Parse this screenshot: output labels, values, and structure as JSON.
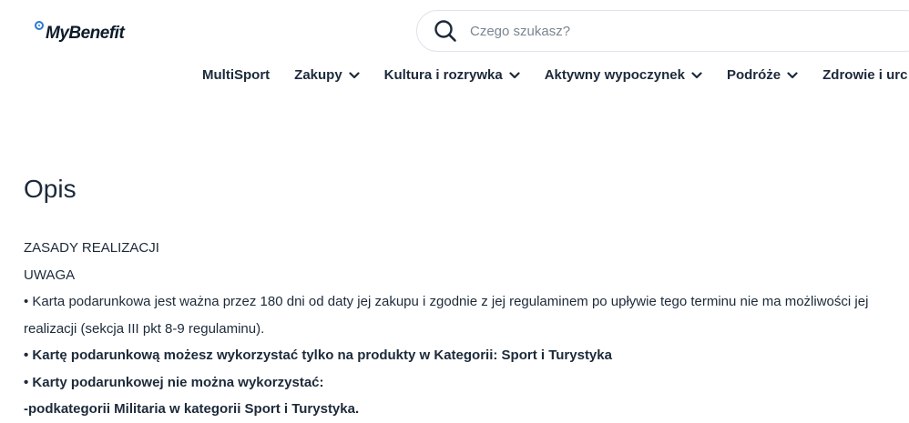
{
  "header": {
    "logo_text": "MyBenefit",
    "search": {
      "placeholder": "Czego szukasz?"
    }
  },
  "nav": {
    "items": [
      {
        "label": "MultiSport",
        "has_dropdown": false
      },
      {
        "label": "Zakupy",
        "has_dropdown": true
      },
      {
        "label": "Kultura i rozrywka",
        "has_dropdown": true
      },
      {
        "label": "Aktywny wypoczynek",
        "has_dropdown": true
      },
      {
        "label": "Podróże",
        "has_dropdown": true
      },
      {
        "label": "Zdrowie i urc",
        "has_dropdown": false
      }
    ]
  },
  "content": {
    "title": "Opis",
    "lines": {
      "rules_heading": "ZASADY REALIZACJI",
      "warning": "UWAGA",
      "bullet1": "• Karta podarunkowa jest ważna przez 180 dni od daty jej zakupu i zgodnie z jej regulaminem po upływie tego terminu nie ma możliwości jej realizacji (sekcja III pkt 8-9 regulaminu).",
      "bullet2": "• Kartę podarunkową możesz wykorzystać tylko na produkty w Kategorii: Sport i Turystyka",
      "bullet3": "• Karty podarunkowej nie można wykorzystać:",
      "exclusion1": "-podkategorii Militaria w kategorii Sport i Turystyka."
    }
  },
  "colors": {
    "text": "#1c2a3a",
    "logo_accent": "#2a78d4",
    "search_border": "#dfe4ea"
  }
}
